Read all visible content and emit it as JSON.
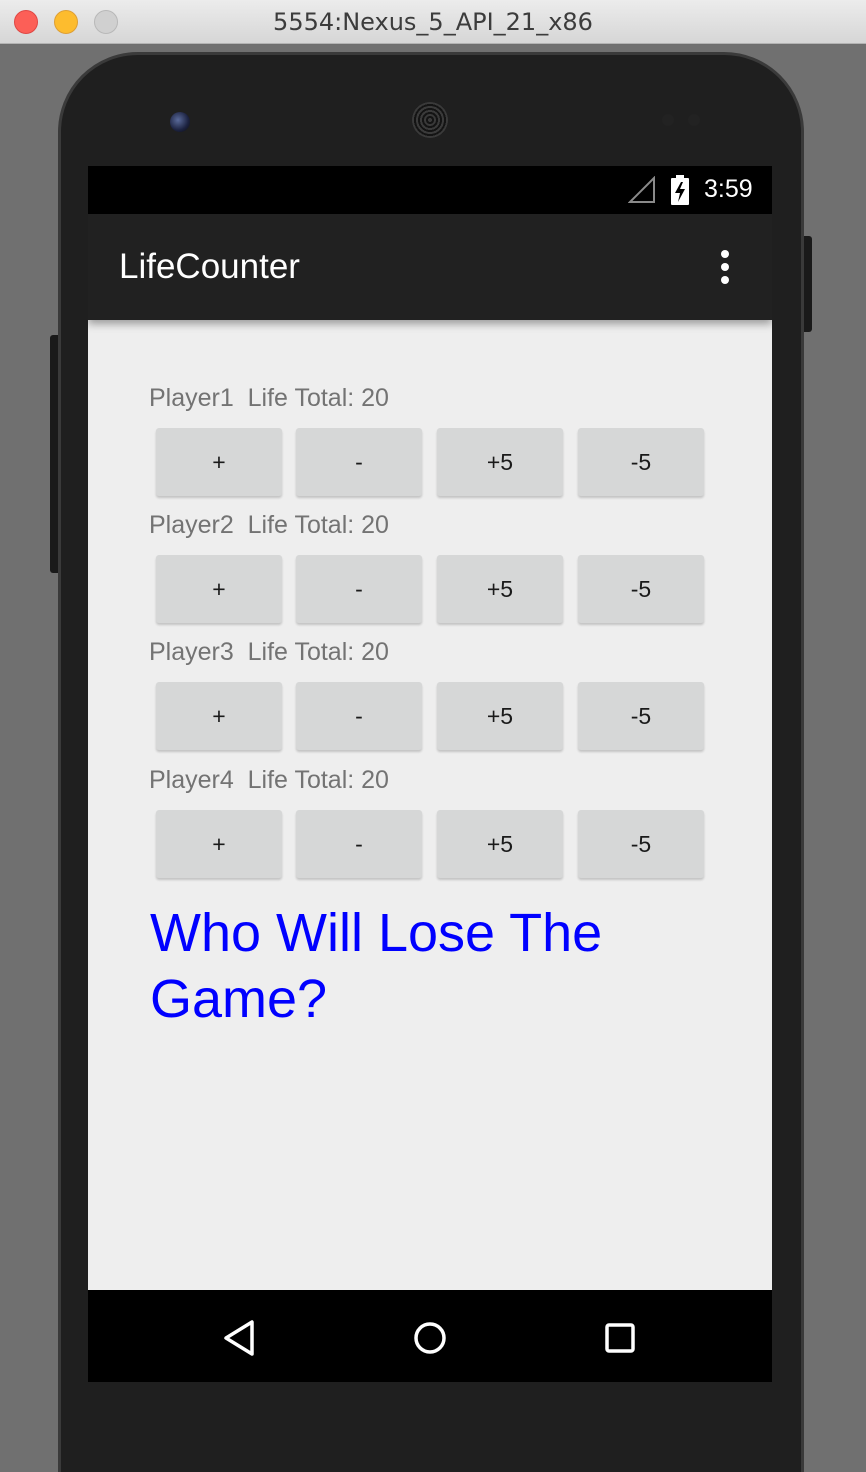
{
  "window": {
    "title": "5554:Nexus_5_API_21_x86"
  },
  "statusbar": {
    "time": "3:59",
    "icons": [
      "signal-icon",
      "battery-charging-icon"
    ]
  },
  "appbar": {
    "title": "LifeCounter",
    "menu_icon": "overflow-menu-icon"
  },
  "players": [
    {
      "label": "Player1  Life Total: 20",
      "buttons": [
        "+",
        "-",
        "+5",
        "-5"
      ]
    },
    {
      "label": "Player2  Life Total: 20",
      "buttons": [
        "+",
        "-",
        "+5",
        "-5"
      ]
    },
    {
      "label": "Player3  Life Total: 20",
      "buttons": [
        "+",
        "-",
        "+5",
        "-5"
      ]
    },
    {
      "label": "Player4  Life Total: 20",
      "buttons": [
        "+",
        "-",
        "+5",
        "-5"
      ]
    }
  ],
  "question": "Who Will Lose The Game?",
  "colors": {
    "question_text": "#0000ff",
    "appbar": "#212121",
    "screen_background": "#eeeeee",
    "button": "#d6d7d7"
  },
  "navbar": {
    "icons": [
      "back-icon",
      "home-icon",
      "recent-apps-icon"
    ]
  }
}
